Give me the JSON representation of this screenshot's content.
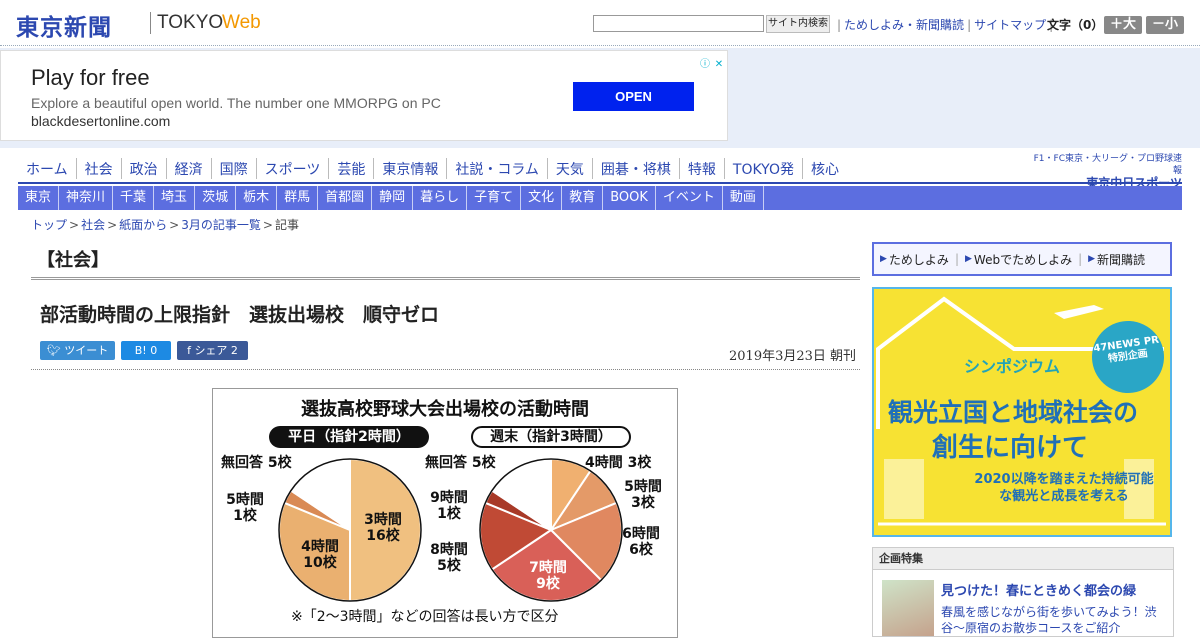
{
  "header": {
    "logo_kanji": "東京新聞",
    "logo_tokyo": "TOKYO",
    "logo_web": "Web",
    "search_button": "サイト内検索",
    "links": [
      "ためしよみ・新聞購読",
      "サイトマップ"
    ],
    "font_size_label": "文字（0）",
    "font_up": "＋大",
    "font_down": "－小"
  },
  "ad": {
    "title": "Play for free",
    "description": "Explore a beautiful open world. The number one MMORPG on PC",
    "url": "blackdesertonline.com",
    "cta": "OPEN",
    "info_icon": "ⓘ",
    "close_icon": "✕"
  },
  "nav_main": [
    "ホーム",
    "社会",
    "政治",
    "経済",
    "国際",
    "スポーツ",
    "芸能",
    "東京情報",
    "社説・コラム",
    "天気",
    "囲碁・将棋",
    "特報",
    "TOKYO発",
    "核心"
  ],
  "chunichi": {
    "top": "F1・FC東京・大リーグ・プロ野球速報",
    "brand": "東京中日スポーツ"
  },
  "nav_region": [
    "東京",
    "神奈川",
    "千葉",
    "埼玉",
    "茨城",
    "栃木",
    "群馬",
    "首都圏",
    "静岡",
    "暮らし",
    "子育て",
    "文化",
    "教育",
    "BOOK",
    "イベント",
    "動画"
  ],
  "breadcrumb": {
    "items": [
      "トップ",
      "社会",
      "紙面から",
      "3月の記事一覧"
    ],
    "current": "記事"
  },
  "article": {
    "section": "【社会】",
    "title": "部活動時間の上限指針　選抜出場校　順守ゼロ",
    "share_tweet": "ツイート",
    "share_hatena": "B!  0",
    "share_facebook": "シェア 2",
    "date": "2019年3月23日 朝刊"
  },
  "chart_data": {
    "type": "pie",
    "title": "選抜高校野球大会出場校の活動時間",
    "note": "※「2～3時間」などの回答は長い方で区分",
    "charts": [
      {
        "name": "平日（指針2時間）",
        "slices": [
          {
            "label": "3時間",
            "count": "16校",
            "value": 16,
            "color": "#f0c080"
          },
          {
            "label": "4時間",
            "count": "10校",
            "value": 10,
            "color": "#eab070"
          },
          {
            "label": "5時間",
            "count": "1校",
            "value": 1,
            "color": "#d98a55"
          },
          {
            "label": "無回答",
            "count": "5校",
            "value": 5,
            "color": "#ffffff"
          }
        ]
      },
      {
        "name": "週末（指針3時間）",
        "slices": [
          {
            "label": "4時間",
            "count": "3校",
            "value": 3,
            "color": "#f0b070"
          },
          {
            "label": "5時間",
            "count": "3校",
            "value": 3,
            "color": "#e49a68"
          },
          {
            "label": "6時間",
            "count": "6校",
            "value": 6,
            "color": "#e08860"
          },
          {
            "label": "7時間",
            "count": "9校",
            "value": 9,
            "color": "#d96058"
          },
          {
            "label": "8時間",
            "count": "5校",
            "value": 5,
            "color": "#c04a35"
          },
          {
            "label": "9時間",
            "count": "1校",
            "value": 1,
            "color": "#a83a28"
          },
          {
            "label": "無回答",
            "count": "5校",
            "value": 5,
            "color": "#ffffff"
          }
        ]
      }
    ]
  },
  "sidebar": {
    "tabs": [
      "ためしよみ",
      "Webでためしよみ",
      "新聞購読"
    ],
    "banner": {
      "badge": "47NEWS PR 特別企画",
      "sub": "シンポジウム",
      "line1": "観光立国と地域社会の",
      "line2": "創生に向けて",
      "desc": "2020以降を踏まえた持続可能な観光と成長を考える"
    },
    "special": {
      "heading": "企画特集",
      "title": "見つけた！春にときめく都会の緑",
      "desc": "春風を感じながら街を歩いてみよう！渋谷～原宿のお散歩コースをご紹介"
    }
  }
}
